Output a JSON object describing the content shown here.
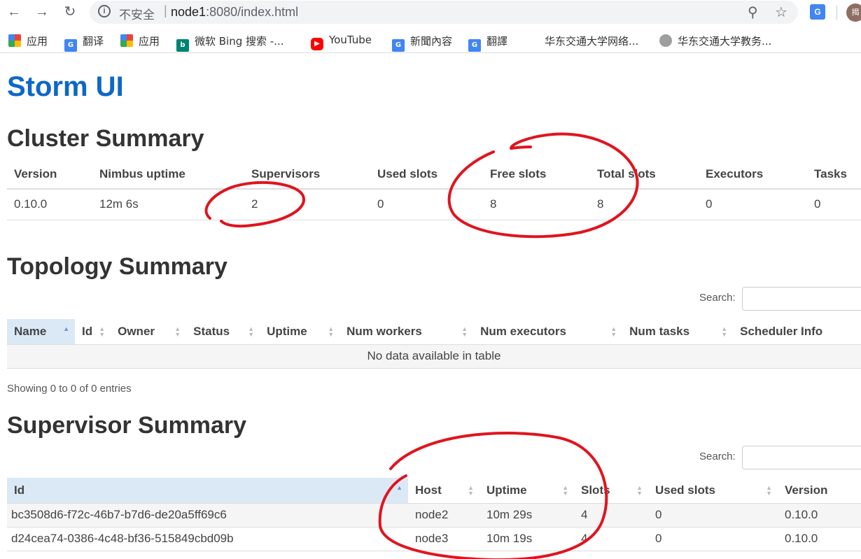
{
  "browser": {
    "back_icon": "arrow-left-icon",
    "forward_icon": "arrow-right-icon",
    "reload_icon": "reload-icon",
    "security_text": "不安全",
    "url_host": "node1",
    "url_path": ":8080/index.html",
    "zoom_icon": "zoom-icon",
    "star_icon": "star-icon",
    "avatar_text": "揭"
  },
  "bookmarks": [
    {
      "label": "应用",
      "icon": "apps-icon"
    },
    {
      "label": "翻译",
      "icon": "translate-icon"
    },
    {
      "label": "应用",
      "icon": "apps-icon"
    },
    {
      "label": "微软 Bing 搜索 -...",
      "icon": "bing-icon"
    },
    {
      "label": "YouTube",
      "icon": "youtube-icon"
    },
    {
      "label": "新聞內容",
      "icon": "news-icon"
    },
    {
      "label": "翻譯",
      "icon": "translate-icon"
    },
    {
      "label": "华东交通大学网络...",
      "icon": ""
    },
    {
      "label": "华东交通大学教务...",
      "icon": "university-icon"
    }
  ],
  "page": {
    "logo": "Storm UI",
    "cluster_title": "Cluster Summary",
    "topology_title": "Topology Summary",
    "supervisor_title": "Supervisor Summary",
    "search_label": "Search:",
    "topology_info": "Showing 0 to 0 of 0 entries"
  },
  "cluster": {
    "headers": [
      "Version",
      "Nimbus uptime",
      "Supervisors",
      "Used slots",
      "Free slots",
      "Total slots",
      "Executors",
      "Tasks"
    ],
    "row": [
      "0.10.0",
      "12m 6s",
      "2",
      "0",
      "8",
      "8",
      "0",
      "0"
    ]
  },
  "topology": {
    "headers": [
      "Name",
      "Id",
      "Owner",
      "Status",
      "Uptime",
      "Num workers",
      "Num executors",
      "Num tasks",
      "Scheduler Info"
    ],
    "empty": "No data available in table"
  },
  "supervisors": {
    "headers": [
      "Id",
      "Host",
      "Uptime",
      "Slots",
      "Used slots",
      "Version"
    ],
    "rows": [
      [
        "bc3508d6-f72c-46b7-b7d6-de20a5ff69c6",
        "node2",
        "10m 29s",
        "4",
        "0",
        "0.10.0"
      ],
      [
        "d24cea74-0386-4c48-bf36-515849cbd09b",
        "node3",
        "10m 19s",
        "4",
        "0",
        "0.10.0"
      ]
    ]
  },
  "colors": {
    "logo": "#0e67c9",
    "annotation": "#e0141e",
    "sorted_header": "#dbe9f6"
  }
}
